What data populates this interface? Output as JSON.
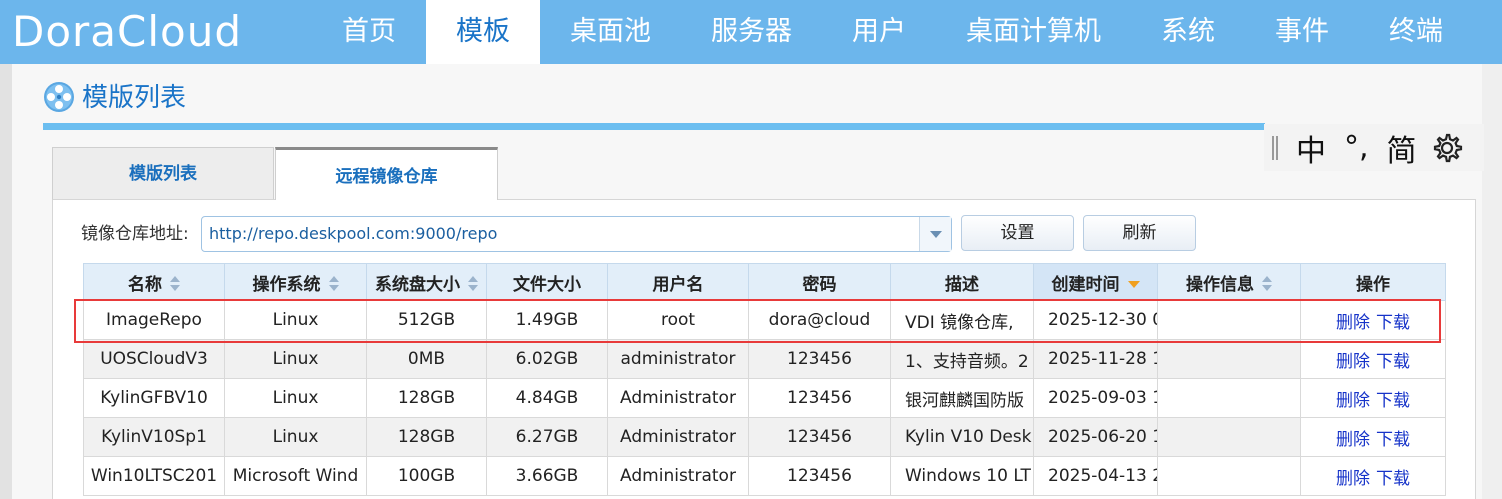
{
  "app": {
    "logo": "DoraCloud"
  },
  "nav": {
    "items": [
      {
        "label": "首页",
        "active": false
      },
      {
        "label": "模板",
        "active": true
      },
      {
        "label": "桌面池",
        "active": false
      },
      {
        "label": "服务器",
        "active": false
      },
      {
        "label": "用户",
        "active": false
      },
      {
        "label": "桌面计算机",
        "active": false
      },
      {
        "label": "系统",
        "active": false
      },
      {
        "label": "事件",
        "active": false
      },
      {
        "label": "终端",
        "active": false
      }
    ]
  },
  "page": {
    "title": "模版列表",
    "icon": "film-reel-icon"
  },
  "ime": {
    "mode": "中",
    "punct": "°,",
    "charset": "简",
    "icon": "gear-icon"
  },
  "tabs": [
    {
      "label": "模版列表",
      "active": false
    },
    {
      "label": "远程镜像仓库",
      "active": true
    }
  ],
  "repo": {
    "label": "镜像仓库地址:",
    "value": "http://repo.deskpool.com:9000/repo",
    "set_button": "设置",
    "refresh_button": "刷新"
  },
  "table": {
    "columns": [
      {
        "label": "名称",
        "sort": "both"
      },
      {
        "label": "操作系统",
        "sort": "both"
      },
      {
        "label": "系统盘大小",
        "sort": "both"
      },
      {
        "label": "文件大小",
        "sort": "none"
      },
      {
        "label": "用户名",
        "sort": "none"
      },
      {
        "label": "密码",
        "sort": "none"
      },
      {
        "label": "描述",
        "sort": "none"
      },
      {
        "label": "创建时间",
        "sort": "desc"
      },
      {
        "label": "操作信息",
        "sort": "both"
      },
      {
        "label": "操作",
        "sort": "none"
      }
    ],
    "rows": [
      {
        "name": "ImageRepo",
        "os": "Linux",
        "disk": "512GB",
        "size": "1.49GB",
        "user": "root",
        "password": "dora@cloud",
        "desc": "VDI 镜像仓库,",
        "created": "2025-12-30 0",
        "info": ""
      },
      {
        "name": "UOSCloudV3",
        "os": "Linux",
        "disk": "0MB",
        "size": "6.02GB",
        "user": "administrator",
        "password": "123456",
        "desc": "1、支持音频。2",
        "created": "2025-11-28 1",
        "info": ""
      },
      {
        "name": "KylinGFBV10",
        "os": "Linux",
        "disk": "128GB",
        "size": "4.84GB",
        "user": "Administrator",
        "password": "123456",
        "desc": "银河麒麟国防版",
        "created": "2025-09-03 1",
        "info": ""
      },
      {
        "name": "KylinV10Sp1",
        "os": "Linux",
        "disk": "128GB",
        "size": "6.27GB",
        "user": "Administrator",
        "password": "123456",
        "desc": "Kylin V10 Desk",
        "created": "2025-06-20 1",
        "info": ""
      },
      {
        "name": "Win10LTSC201",
        "os": "Microsoft Wind",
        "disk": "100GB",
        "size": "3.66GB",
        "user": "Administrator",
        "password": "123456",
        "desc": "Windows 10 LT",
        "created": "2025-04-13 2",
        "info": ""
      }
    ],
    "actions": {
      "delete": "删除",
      "download": "下载"
    }
  },
  "colors": {
    "nav_bg": "#6cb6ec",
    "accent": "#1a74c8",
    "link": "#1633c9",
    "highlight": "#e83a3a"
  }
}
